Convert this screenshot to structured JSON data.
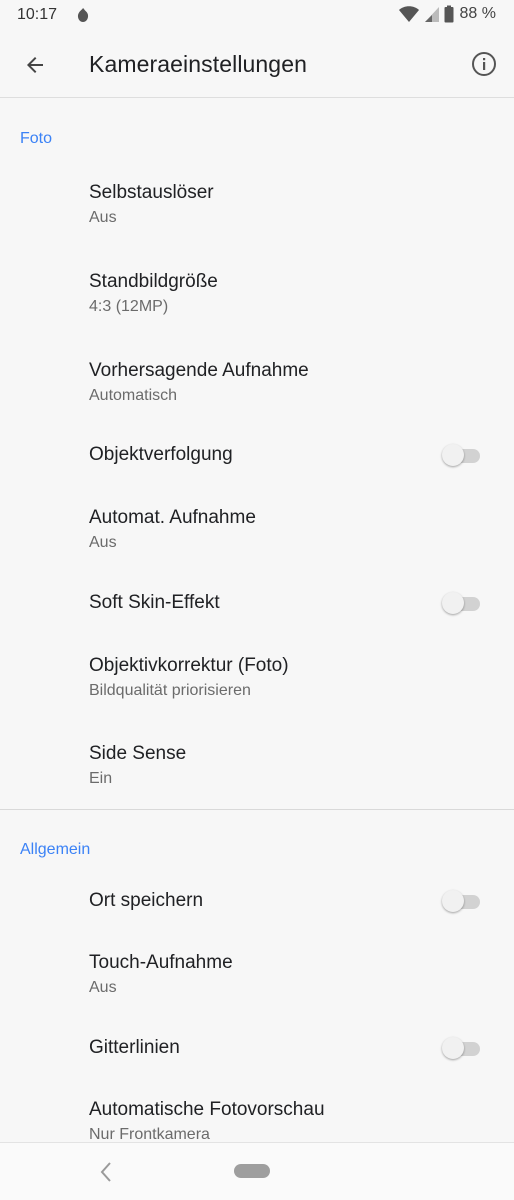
{
  "status_bar": {
    "time": "10:17",
    "battery": "88 %"
  },
  "app_bar": {
    "title": "Kameraeinstellungen",
    "back_icon": "arrow-back-icon",
    "info_icon": "info-icon"
  },
  "sections": {
    "foto": {
      "header": "Foto",
      "items": [
        {
          "title": "Selbstauslöser",
          "subtitle": "Aus"
        },
        {
          "title": "Standbildgröße",
          "subtitle": "4:3 (12MP)"
        },
        {
          "title": "Vorhersagende Aufnahme",
          "subtitle": "Automatisch"
        },
        {
          "title": "Objektverfolgung",
          "toggle": false
        },
        {
          "title": "Automat. Aufnahme",
          "subtitle": "Aus"
        },
        {
          "title": "Soft Skin-Effekt",
          "toggle": false
        },
        {
          "title": "Objektivkorrektur (Foto)",
          "subtitle": "Bildqualität priorisieren"
        },
        {
          "title": "Side Sense",
          "subtitle": "Ein"
        }
      ]
    },
    "allgemein": {
      "header": "Allgemein",
      "items": [
        {
          "title": "Ort speichern",
          "toggle": false
        },
        {
          "title": "Touch-Aufnahme",
          "subtitle": "Aus"
        },
        {
          "title": "Gitterlinien",
          "toggle": false
        },
        {
          "title": "Automatische Fotovorschau",
          "subtitle": "Nur Frontkamera"
        }
      ]
    }
  },
  "colors": {
    "accent": "#3b82f6",
    "background": "#f7f7f7"
  }
}
